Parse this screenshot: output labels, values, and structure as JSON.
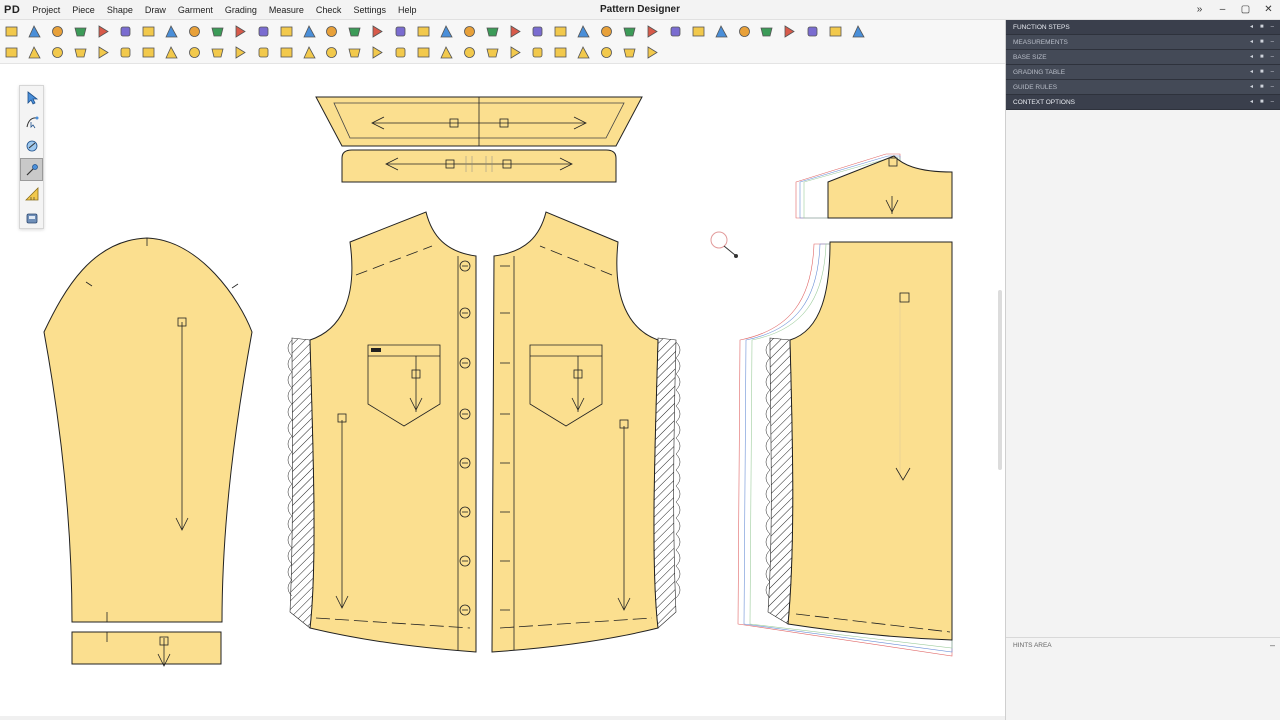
{
  "app": {
    "logo": "PD",
    "title": "Pattern Designer",
    "menu": [
      "Project",
      "Piece",
      "Shape",
      "Draw",
      "Garment",
      "Grading",
      "Measure",
      "Check",
      "Settings",
      "Help"
    ],
    "window_controls": [
      "»",
      "–",
      "▢",
      "✕"
    ]
  },
  "toolbar1": {
    "icons": [
      "new-project-icon",
      "open-icon",
      "save-icon",
      "save-as-icon",
      "grade-icon",
      "scissors-icon",
      "piece-icon",
      "print-icon",
      "plot-icon",
      "export-icon",
      "undo-icon",
      "redo-icon",
      "select-piece-icon",
      "duplicate-icon",
      "mirror-icon",
      "fold-icon",
      "notch-icon",
      "layer-icon",
      "color-wheel-icon",
      "grid-icon",
      "measure-icon",
      "arrow-icon",
      "table-icon",
      "zoom-fit-icon",
      "zoom-box-icon",
      "zoom-in-icon",
      "zoom-out-icon",
      "zoom-all-icon",
      "zoom-prev-icon",
      "palette-icon",
      "settings-icon",
      "sync-icon",
      "help-icon",
      "flag-icon",
      "style-icon",
      "check-icon",
      "tool-icon",
      "preview-icon"
    ]
  },
  "toolbar2": {
    "icons": [
      "draw-piece-icon",
      "fill-icon",
      "shape-1-icon",
      "shape-2-icon",
      "shape-3-icon",
      "shape-4-icon",
      "shape-5-icon",
      "shape-6-icon",
      "shape-7-icon",
      "shape-8-icon",
      "shape-9-icon",
      "shape-10-icon",
      "shape-11-icon",
      "shape-12-icon",
      "shape-13-icon",
      "shape-14-icon",
      "shape-15-icon",
      "shape-16-icon",
      "shape-17-icon",
      "shape-18-icon",
      "shape-19-icon",
      "shape-20-icon",
      "shape-21-icon",
      "shape-22-icon",
      "shape-23-icon",
      "shape-24-icon",
      "shape-25-icon",
      "shape-26-icon",
      "shape-27-icon"
    ]
  },
  "palette": {
    "tools": [
      "pointer-icon",
      "curve-point-icon",
      "measure-tape-icon",
      "pin-icon",
      "ruler-icon",
      "tablet-icon"
    ],
    "active_index": 3
  },
  "right_panel": {
    "sections": [
      {
        "label": "FUNCTION STEPS",
        "active": true
      },
      {
        "label": "MEASUREMENTS",
        "active": false
      },
      {
        "label": "BASE SIZE",
        "active": false
      },
      {
        "label": "GRADING TABLE",
        "active": false
      },
      {
        "label": "GUIDE RULES",
        "active": false
      },
      {
        "label": "CONTEXT OPTIONS",
        "active": true
      }
    ],
    "hints_label": "HINTS AREA",
    "section_icon_names": [
      "pin-icon",
      "lock-icon",
      "minimize-icon"
    ]
  },
  "colors": {
    "piece_fill": "#fbdf8f",
    "piece_stroke": "#222222",
    "panel_header": "#3a3f4c",
    "grade_line_1": "#e06666",
    "grade_line_2": "#6a8fd6",
    "grade_line_3": "#9ccc9c"
  }
}
